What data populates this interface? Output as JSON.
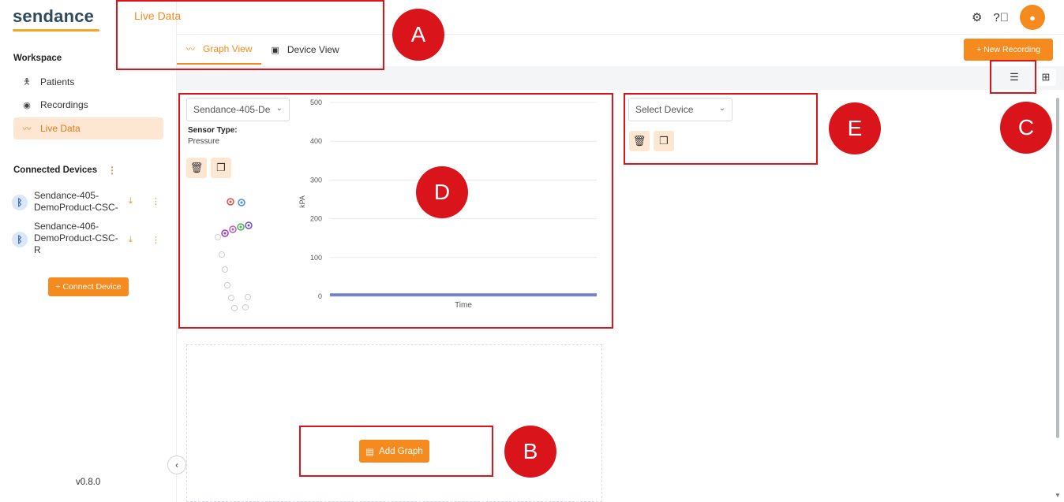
{
  "app": {
    "brand": "sendance",
    "page_title": "Live Data",
    "version": "v0.8.0"
  },
  "colors": {
    "accent": "#f58a1f",
    "accent_light": "#fde7d3",
    "annotation": "#d9141a"
  },
  "sidebar": {
    "workspace_title": "Workspace",
    "items": [
      {
        "label": "Patients",
        "icon": "person-icon"
      },
      {
        "label": "Recordings",
        "icon": "record-icon"
      },
      {
        "label": "Live Data",
        "icon": "trend-icon",
        "active": true
      }
    ],
    "connected_title": "Connected Devices",
    "devices": [
      {
        "name": "Sendance-405-DemoProduct-CSC-"
      },
      {
        "name": "Sendance-406-DemoProduct-CSC-R"
      }
    ],
    "connect_button": "+ Connect Device"
  },
  "tabs": [
    {
      "label": "Graph View",
      "icon": "trend-icon",
      "active": true
    },
    {
      "label": "Device View",
      "icon": "image-icon",
      "active": false
    }
  ],
  "actions": {
    "new_recording": "+ New Recording",
    "add_graph": "Add Graph"
  },
  "graph_card": {
    "device_select": "Sendance-405-De",
    "sensor_type_label": "Sensor Type:",
    "sensor_type_value": "Pressure",
    "chart": {
      "ylabel": "kPA",
      "xlabel": "Time",
      "yticks": [
        "500",
        "400",
        "300",
        "200",
        "100",
        "0"
      ]
    }
  },
  "second_card": {
    "device_select": "Select Device"
  },
  "annotations": [
    {
      "label": "A"
    },
    {
      "label": "B"
    },
    {
      "label": "C"
    },
    {
      "label": "D"
    },
    {
      "label": "E"
    }
  ]
}
